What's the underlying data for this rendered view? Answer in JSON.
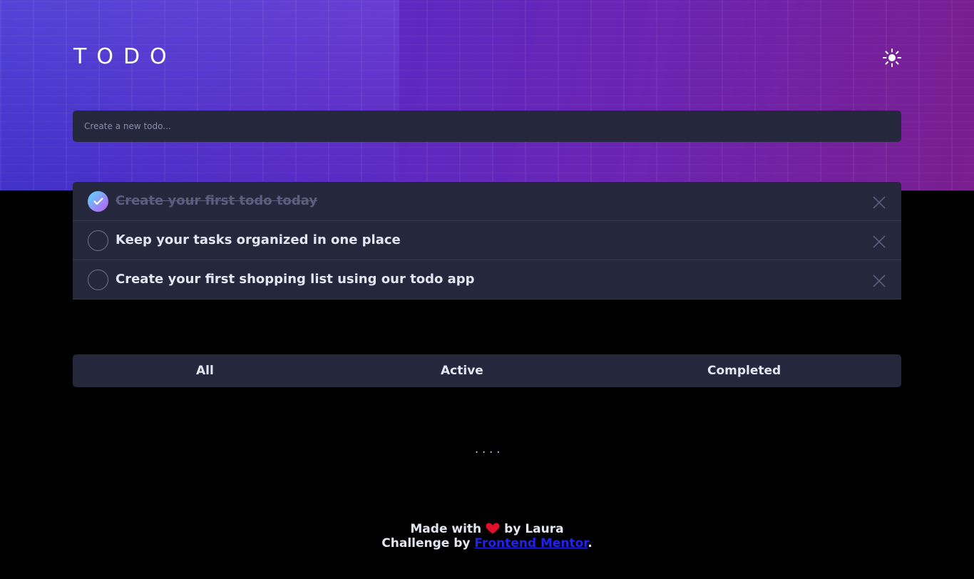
{
  "header": {
    "title": "TODO"
  },
  "theme_toggle": {
    "icon": "sun-icon"
  },
  "new_todo": {
    "placeholder": "Create a new todo..."
  },
  "todos": [
    {
      "text": "Create your first todo today",
      "completed": true
    },
    {
      "text": "Keep your tasks organized in one place",
      "completed": false
    },
    {
      "text": "Create your first shopping list using our todo app",
      "completed": false
    }
  ],
  "filters": {
    "all": "All",
    "active": "Active",
    "completed": "Completed"
  },
  "more_indicator": "....",
  "footer": {
    "made_with": "Made with",
    "by": "by Laura",
    "challenge_by": "Challenge by",
    "link_text": "Frontend Mentor",
    "period": "."
  },
  "colors": {
    "background": "#000000",
    "panel": "#25273d",
    "text": "#e4e5f1",
    "check_gradient_start": "#55ddff",
    "check_gradient_end": "#c058f3",
    "heart": "#e0102a",
    "link": "#2222ee"
  }
}
